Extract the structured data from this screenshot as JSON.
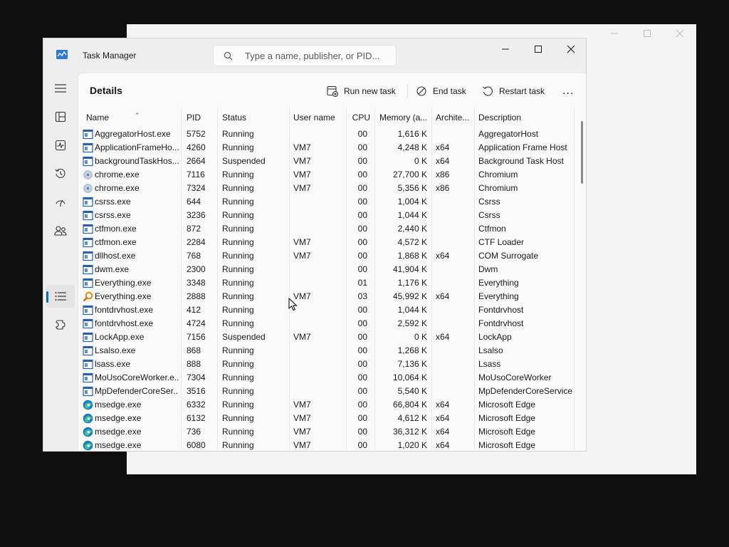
{
  "window": {
    "title": "Task Manager",
    "search_placeholder": "Type a name, publisher, or PID..."
  },
  "sidebar": {
    "items": [
      {
        "name": "menu-icon"
      },
      {
        "name": "processes-icon"
      },
      {
        "name": "performance-icon"
      },
      {
        "name": "app-history-icon"
      },
      {
        "name": "startup-apps-icon"
      },
      {
        "name": "users-icon"
      },
      {
        "name": "details-icon"
      },
      {
        "name": "services-icon"
      },
      {
        "name": "settings-icon"
      }
    ],
    "active": "details"
  },
  "page": {
    "title": "Details",
    "run_new_task": "Run new task",
    "end_task": "End task",
    "restart_task": "Restart task",
    "more": "..."
  },
  "table": {
    "headers": {
      "name": "Name",
      "pid": "PID",
      "status": "Status",
      "user": "User name",
      "cpu": "CPU",
      "memory": "Memory (a...",
      "arch": "Archite...",
      "desc": "Description"
    },
    "rows": [
      {
        "icon": "app",
        "name": "AggregatorHost.exe",
        "pid": "5752",
        "status": "Running",
        "user": "",
        "cpu": "00",
        "memory": "1,616 K",
        "arch": "",
        "desc": "AggregatorHost"
      },
      {
        "icon": "app",
        "name": "ApplicationFrameHo...",
        "pid": "4260",
        "status": "Running",
        "user": "VM7",
        "cpu": "00",
        "memory": "4,248 K",
        "arch": "x64",
        "desc": "Application Frame Host"
      },
      {
        "icon": "app",
        "name": "backgroundTaskHos...",
        "pid": "2664",
        "status": "Suspended",
        "user": "VM7",
        "cpu": "00",
        "memory": "0 K",
        "arch": "x64",
        "desc": "Background Task Host"
      },
      {
        "icon": "chrome",
        "name": "chrome.exe",
        "pid": "7116",
        "status": "Running",
        "user": "VM7",
        "cpu": "00",
        "memory": "27,700 K",
        "arch": "x86",
        "desc": "Chromium"
      },
      {
        "icon": "chrome",
        "name": "chrome.exe",
        "pid": "7324",
        "status": "Running",
        "user": "VM7",
        "cpu": "00",
        "memory": "5,356 K",
        "arch": "x86",
        "desc": "Chromium"
      },
      {
        "icon": "app",
        "name": "csrss.exe",
        "pid": "644",
        "status": "Running",
        "user": "",
        "cpu": "00",
        "memory": "1,004 K",
        "arch": "",
        "desc": "Csrss"
      },
      {
        "icon": "app",
        "name": "csrss.exe",
        "pid": "3236",
        "status": "Running",
        "user": "",
        "cpu": "00",
        "memory": "1,044 K",
        "arch": "",
        "desc": "Csrss"
      },
      {
        "icon": "app",
        "name": "ctfmon.exe",
        "pid": "872",
        "status": "Running",
        "user": "",
        "cpu": "00",
        "memory": "2,440 K",
        "arch": "",
        "desc": "Ctfmon"
      },
      {
        "icon": "app",
        "name": "ctfmon.exe",
        "pid": "2284",
        "status": "Running",
        "user": "VM7",
        "cpu": "00",
        "memory": "4,572 K",
        "arch": "",
        "desc": "CTF Loader"
      },
      {
        "icon": "app",
        "name": "dllhost.exe",
        "pid": "768",
        "status": "Running",
        "user": "VM7",
        "cpu": "00",
        "memory": "1,868 K",
        "arch": "x64",
        "desc": "COM Surrogate"
      },
      {
        "icon": "app",
        "name": "dwm.exe",
        "pid": "2300",
        "status": "Running",
        "user": "",
        "cpu": "00",
        "memory": "41,904 K",
        "arch": "",
        "desc": "Dwm"
      },
      {
        "icon": "app",
        "name": "Everything.exe",
        "pid": "3348",
        "status": "Running",
        "user": "",
        "cpu": "01",
        "memory": "1,176 K",
        "arch": "",
        "desc": "Everything"
      },
      {
        "icon": "everything",
        "name": "Everything.exe",
        "pid": "2888",
        "status": "Running",
        "user": "VM7",
        "cpu": "03",
        "memory": "45,992 K",
        "arch": "x64",
        "desc": "Everything"
      },
      {
        "icon": "app",
        "name": "fontdrvhost.exe",
        "pid": "412",
        "status": "Running",
        "user": "",
        "cpu": "00",
        "memory": "1,044 K",
        "arch": "",
        "desc": "Fontdrvhost"
      },
      {
        "icon": "app",
        "name": "fontdrvhost.exe",
        "pid": "4724",
        "status": "Running",
        "user": "",
        "cpu": "00",
        "memory": "2,592 K",
        "arch": "",
        "desc": "Fontdrvhost"
      },
      {
        "icon": "app",
        "name": "LockApp.exe",
        "pid": "7156",
        "status": "Suspended",
        "user": "VM7",
        "cpu": "00",
        "memory": "0 K",
        "arch": "x64",
        "desc": "LockApp"
      },
      {
        "icon": "app",
        "name": "Lsalso.exe",
        "pid": "868",
        "status": "Running",
        "user": "",
        "cpu": "00",
        "memory": "1,268 K",
        "arch": "",
        "desc": "Lsalso"
      },
      {
        "icon": "app",
        "name": "lsass.exe",
        "pid": "888",
        "status": "Running",
        "user": "",
        "cpu": "00",
        "memory": "7,136 K",
        "arch": "",
        "desc": "Lsass"
      },
      {
        "icon": "app",
        "name": "MoUsoCoreWorker.e...",
        "pid": "7304",
        "status": "Running",
        "user": "",
        "cpu": "00",
        "memory": "10,064 K",
        "arch": "",
        "desc": "MoUsoCoreWorker"
      },
      {
        "icon": "app",
        "name": "MpDefenderCoreSer...",
        "pid": "3516",
        "status": "Running",
        "user": "",
        "cpu": "00",
        "memory": "5,540 K",
        "arch": "",
        "desc": "MpDefenderCoreService"
      },
      {
        "icon": "edge",
        "name": "msedge.exe",
        "pid": "6332",
        "status": "Running",
        "user": "VM7",
        "cpu": "00",
        "memory": "66,804 K",
        "arch": "x64",
        "desc": "Microsoft Edge"
      },
      {
        "icon": "edge",
        "name": "msedge.exe",
        "pid": "6132",
        "status": "Running",
        "user": "VM7",
        "cpu": "00",
        "memory": "4,612 K",
        "arch": "x64",
        "desc": "Microsoft Edge"
      },
      {
        "icon": "edge",
        "name": "msedge.exe",
        "pid": "736",
        "status": "Running",
        "user": "VM7",
        "cpu": "00",
        "memory": "36,312 K",
        "arch": "x64",
        "desc": "Microsoft Edge"
      },
      {
        "icon": "edge",
        "name": "msedge.exe",
        "pid": "6080",
        "status": "Running",
        "user": "VM7",
        "cpu": "00",
        "memory": "1,020 K",
        "arch": "x64",
        "desc": "Microsoft Edge"
      }
    ]
  },
  "colors": {
    "accent": "#0067c0",
    "background": "#0f0f0f"
  }
}
